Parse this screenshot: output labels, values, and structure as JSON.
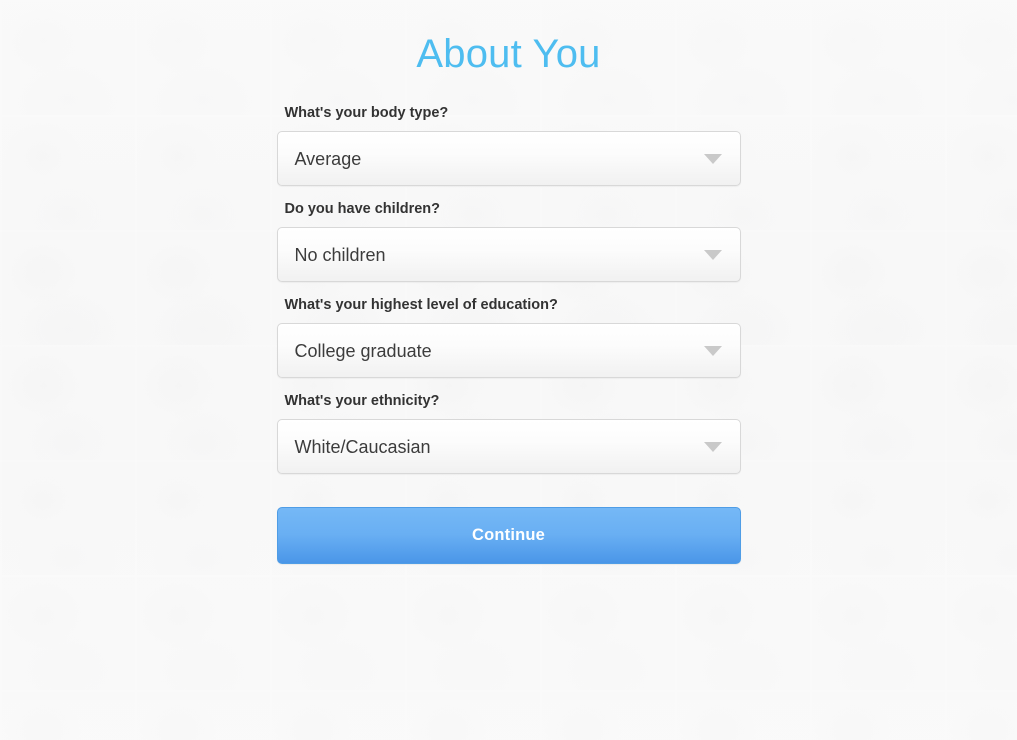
{
  "page": {
    "title": "About You",
    "title_color": "#4ebdf0",
    "background_color": "#f7f7f7"
  },
  "form": {
    "fields": [
      {
        "label": "What's your body type?",
        "value": "Average",
        "icon": "chevron-down-icon"
      },
      {
        "label": "Do you have children?",
        "value": "No children",
        "icon": "chevron-down-icon"
      },
      {
        "label": "What's your highest level of education?",
        "value": "College graduate",
        "icon": "chevron-down-icon"
      },
      {
        "label": "What's your ethnicity?",
        "value": "White/Caucasian",
        "icon": "chevron-down-icon"
      }
    ],
    "submit": {
      "label": "Continue",
      "accent_color_top": "#75b8f6",
      "accent_color_bottom": "#4a96e8",
      "text_color": "#ffffff"
    }
  }
}
